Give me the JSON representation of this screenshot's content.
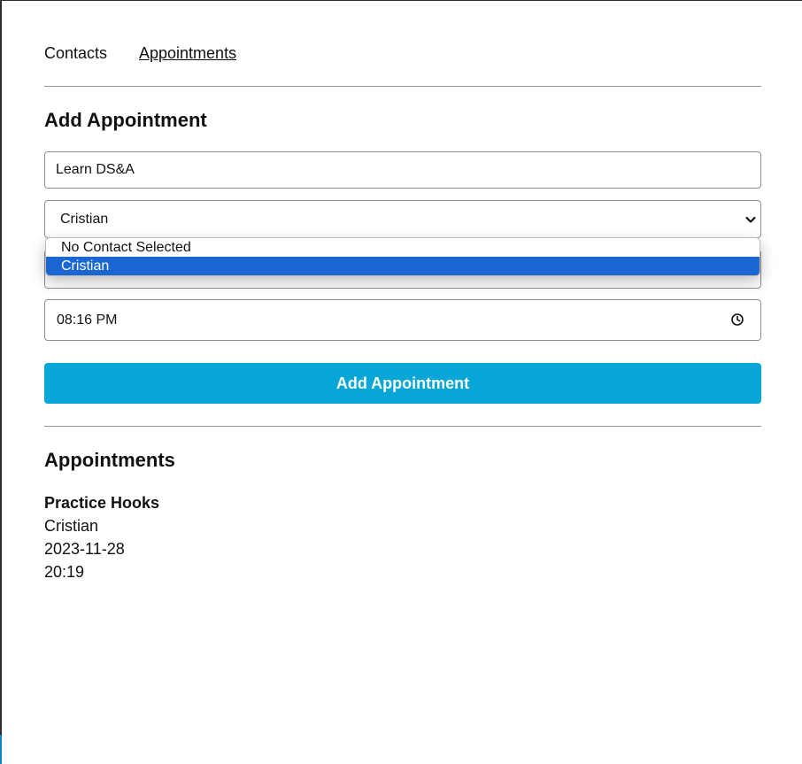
{
  "nav": {
    "contacts_label": "Contacts",
    "appointments_label": "Appointments"
  },
  "form": {
    "title": "Add Appointment",
    "title_input_value": "Learn DS&A",
    "contact_select": {
      "selected": "Cristian",
      "options": [
        "No Contact Selected",
        "Cristian"
      ],
      "highlighted_index": 1
    },
    "time_input_value": "08:16 PM",
    "submit_label": "Add Appointment"
  },
  "list": {
    "title": "Appointments",
    "items": [
      {
        "name": "Practice Hooks",
        "contact": "Cristian",
        "date": "2023-11-28",
        "time": "20:19"
      }
    ]
  },
  "colors": {
    "accent": "#06a7d6",
    "selection": "#1a66d2"
  },
  "icons": {
    "select_caret": "chevron-down-icon",
    "time_picker": "clock-icon"
  }
}
